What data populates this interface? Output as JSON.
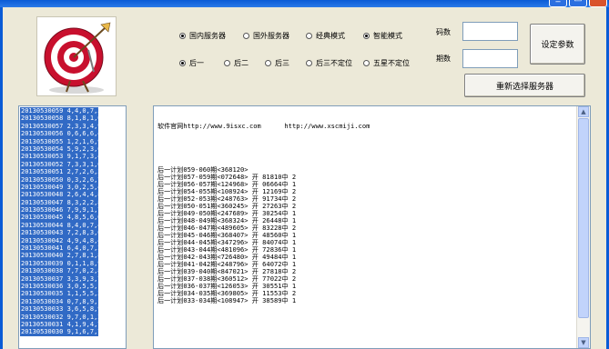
{
  "controls": {
    "server_options": [
      {
        "label": "国内服务器",
        "selected": true
      },
      {
        "label": "国外服务器",
        "selected": false
      },
      {
        "label": "经典模式",
        "selected": false
      },
      {
        "label": "智能模式",
        "selected": true
      }
    ],
    "position_options": [
      {
        "label": "后一",
        "selected": true
      },
      {
        "label": "后二",
        "selected": false
      },
      {
        "label": "后三",
        "selected": false
      },
      {
        "label": "后三不定位",
        "selected": false
      },
      {
        "label": "五星不定位",
        "selected": false
      }
    ],
    "code_count_label": "码数",
    "code_count_value": "",
    "period_count_label": "期数",
    "period_count_value": "",
    "set_params_button": "设定参数",
    "reselect_server_button": "重新选择服务器"
  },
  "history_list": [
    "20130530059 4,4,0,7,3",
    "20130530058 8,1,8,1,0",
    "20130530057 2,3,3,4,9",
    "20130530056 0,6,6,6,4",
    "20130530055 1,2,1,6,9",
    "20130530054 5,9,2,3,6",
    "20130530053 9,1,7,3,4",
    "20130530052 7,3,3,1,0",
    "20130530051 2,7,2,6,3",
    "20130530050 0,3,2,6,7",
    "20130530049 3,0,2,5,4",
    "20130530048 2,6,4,4,8",
    "20130530047 8,3,2,2,8",
    "20130530046 7,9,9,1,7",
    "20130530045 4,8,5,6,0",
    "20130530044 8,4,0,7,4",
    "20130530043 7,2,8,3,6",
    "20130530042 4,9,4,8,4",
    "20130530041 6,4,0,7,2",
    "20130530040 2,7,8,1,8",
    "20130530039 0,1,1,8,9",
    "20130530038 7,7,0,2,8",
    "20130530037 3,3,9,3,7",
    "20130530036 3,0,5,5,1",
    "20130530035 1,1,5,5,3",
    "20130530034 0,7,8,9,1",
    "20130530033 3,6,5,8,9",
    "20130530032 9,7,0,1,2",
    "20130530031 4,1,9,4,7",
    "20130530030 9,1,6,7,7"
  ],
  "log": {
    "header": "软件官网http://www.9isxc.com      http://www.xscmiji.com",
    "lines": [
      "后一计划059-060期<368120>",
      "后一计划057-059期<072648> 开 81810中 2",
      "后一计划056-057期<124968> 开 06664中 1",
      "后一计划054-055期<108924> 开 12169中 2",
      "后一计划052-053期<248763> 开 91734中 2",
      "后一计划050-051期<360245> 开 27263中 2",
      "后一计划049-050期<247689> 开 30254中 1",
      "后一计划048-049期<368324> 开 26448中 1",
      "后一计划046-047期<489605> 开 83228中 2",
      "后一计划045-046期<368407> 开 48560中 1",
      "后一计划044-045期<347296> 开 84074中 1",
      "后一计划043-044期<481096> 开 72836中 1",
      "后一计划042-043期<726480> 开 49484中 1",
      "后一计划041-042期<248796> 开 64072中 1",
      "后一计划039-040期<847021> 开 27818中 2",
      "后一计划037-038期<360512> 开 77022中 2",
      "后一计划036-037期<126053> 开 30551中 1",
      "后一计划034-035期<369805> 开 11553中 2",
      "后一计划033-034期<108947> 开 38589中 1"
    ]
  }
}
